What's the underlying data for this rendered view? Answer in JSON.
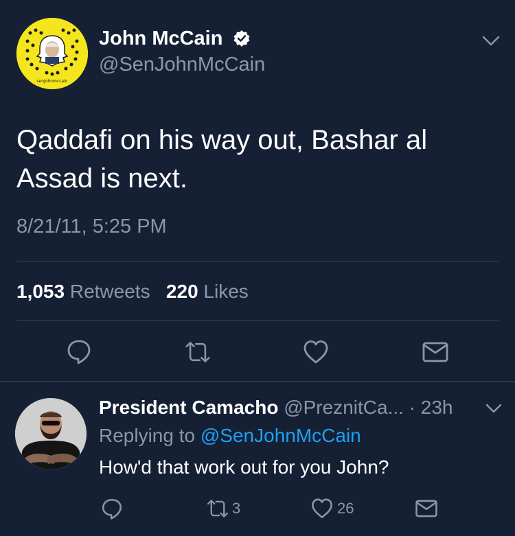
{
  "tweet": {
    "author_name": "John McCain",
    "author_handle": "@SenJohnMcCain",
    "avatar_caption": "senjohnmccain",
    "text": "Qaddafi on his way out, Bashar al Assad is next.",
    "timestamp": "8/21/11, 5:25 PM",
    "retweet_count": "1,053",
    "retweet_label": "Retweets",
    "like_count": "220",
    "like_label": "Likes",
    "actions": [
      "reply-icon",
      "retweet-icon",
      "like-icon",
      "dm-icon"
    ]
  },
  "reply": {
    "author_name": "President Camacho",
    "author_handle_time": "@PreznitCa... · 23h",
    "replying_prefix": "Replying to",
    "replying_handle": "@SenJohnMcCain",
    "text": "How'd that work out for you John?",
    "retweet_count": "3",
    "like_count": "26"
  },
  "colors": {
    "background": "#162035",
    "secondary_text": "#8899a6",
    "link": "#1da1f2",
    "divider": "#38444d",
    "snapcode_yellow": "#f5e51c"
  }
}
